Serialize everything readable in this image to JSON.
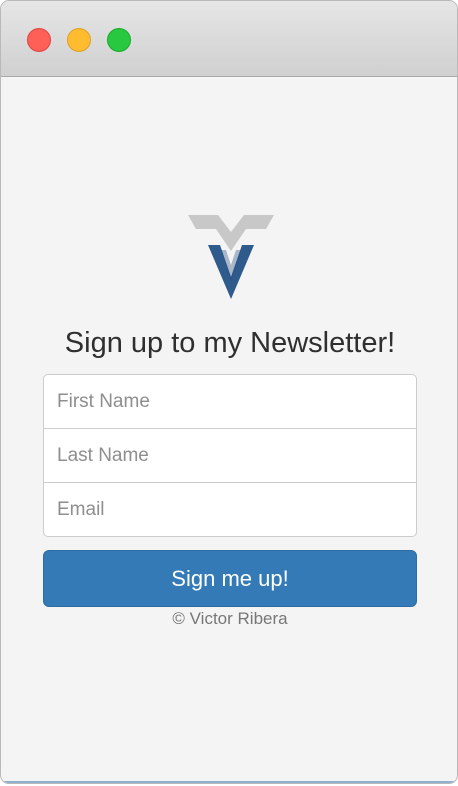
{
  "window": {
    "controls": [
      "close",
      "minimize",
      "zoom"
    ]
  },
  "logo": {
    "icon": "vr-logo-icon",
    "colors": {
      "outline": "#c8c8c8",
      "inner": "#2f5a8c"
    }
  },
  "title": "Sign up to my Newsletter!",
  "form": {
    "first_name": {
      "placeholder": "First Name",
      "value": ""
    },
    "last_name": {
      "placeholder": "Last Name",
      "value": ""
    },
    "email": {
      "placeholder": "Email",
      "value": ""
    },
    "submit_label": "Sign me up!"
  },
  "footer": "© Victor Ribera",
  "colors": {
    "background": "#f4f4f4",
    "button": "#337ab7"
  }
}
